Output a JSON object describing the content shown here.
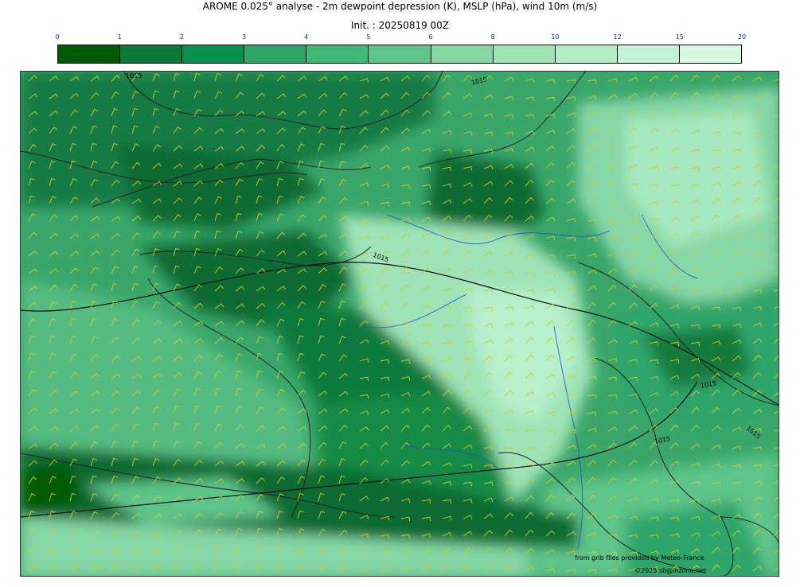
{
  "title": "AROME 0.025° analyse - 2m dewpoint depression (K), MSLP (hPa), wind 10m (m/s)",
  "subtitle": "Init. : 20250819 00Z",
  "colorbar": {
    "ticks": [
      "0",
      "1",
      "2",
      "3",
      "4",
      "5",
      "6",
      "8",
      "10",
      "12",
      "15",
      "20"
    ],
    "colors": [
      "#005a00",
      "#0b7a3a",
      "#08904e",
      "#2fa56a",
      "#40b878",
      "#5fc48a",
      "#86d6a6",
      "#9fe3b6",
      "#b2edc6",
      "#c4f2d4",
      "#d8f8e2"
    ]
  },
  "isobars": {
    "labels": [
      "1019",
      "1019",
      "1015",
      "1015",
      "1015",
      "1015"
    ]
  },
  "credits": {
    "line1": "from grib files provided by Meteo-France",
    "line2": "©2025 sb@inzone.net"
  }
}
